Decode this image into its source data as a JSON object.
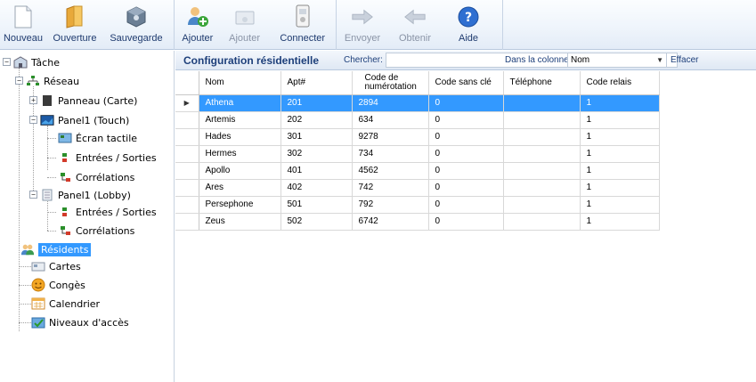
{
  "toolbar": {
    "new_label": "Nouveau",
    "open_label": "Ouverture",
    "save_label": "Sauvegarde",
    "add_label": "Ajouter",
    "add2_label": "Ajouter",
    "connect_label": "Connecter",
    "send_label": "Envoyer",
    "get_label": "Obtenir",
    "help_label": "Aide"
  },
  "tree": {
    "root": "Tâche",
    "network": "Réseau",
    "panel_card": "Panneau (Carte)",
    "panel1_touch": "Panel1 (Touch)",
    "touch_screen": "Écran tactile",
    "inputs_outputs_1": "Entrées / Sorties",
    "correlations_1": "Corrélations",
    "panel1_lobby": "Panel1 (Lobby)",
    "inputs_outputs_2": "Entrées / Sorties",
    "correlations_2": "Corrélations",
    "residents": "Résidents",
    "cards": "Cartes",
    "holidays": "Congès",
    "calendar": "Calendrier",
    "access_levels": "Niveaux d'accès"
  },
  "grid": {
    "title": "Configuration résidentielle",
    "search_label": "Chercher:",
    "search_value": "",
    "column_label": "Dans la colonne",
    "column_value": "Nom",
    "clear_label": "Effacer",
    "columns": [
      "Nom",
      "Apt#",
      "Code de numérotation",
      "Code sans clé",
      "Téléphone",
      "Code relais"
    ],
    "rows": [
      [
        "Athena",
        "201",
        "2894",
        "0",
        "",
        "1"
      ],
      [
        "Artemis",
        "202",
        "634",
        "0",
        "",
        "1"
      ],
      [
        "Hades",
        "301",
        "9278",
        "0",
        "",
        "1"
      ],
      [
        "Hermes",
        "302",
        "734",
        "0",
        "",
        "1"
      ],
      [
        "Apollo",
        "401",
        "4562",
        "0",
        "",
        "1"
      ],
      [
        "Ares",
        "402",
        "742",
        "0",
        "",
        "1"
      ],
      [
        "Persephone",
        "501",
        "792",
        "0",
        "",
        "1"
      ],
      [
        "Zeus",
        "502",
        "6742",
        "0",
        "",
        "1"
      ]
    ]
  },
  "colors": {
    "selection": "#3399ff",
    "toolbar_text": "#1e3a6e"
  }
}
